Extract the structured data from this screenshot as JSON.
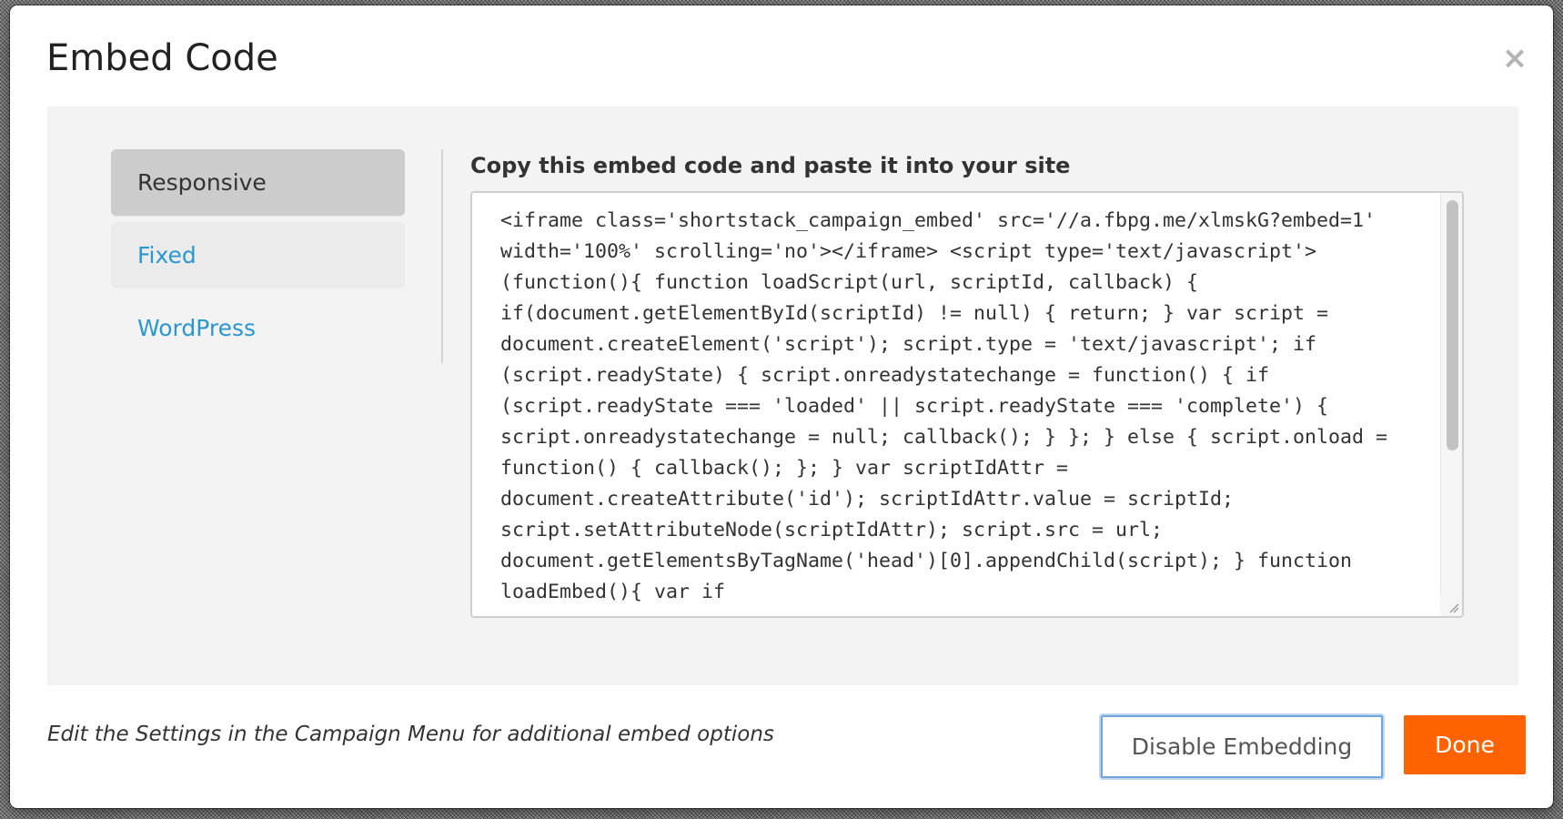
{
  "modal": {
    "title": "Embed Code",
    "close_glyph": "×",
    "close_icon": "close-icon"
  },
  "nav": {
    "items": [
      {
        "label": "Responsive",
        "state": "active"
      },
      {
        "label": "Fixed",
        "state": "hover"
      },
      {
        "label": "WordPress",
        "state": "default"
      }
    ]
  },
  "embed": {
    "label": "Copy this embed code and paste it into your site",
    "code": "<iframe class='shortstack_campaign_embed' src='//a.fbpg.me/xlmskG?embed=1' width='100%' scrolling='no'></iframe> <script type='text/javascript'> (function(){ function loadScript(url, scriptId, callback) { if(document.getElementById(scriptId) != null) { return; } var script = document.createElement('script'); script.type = 'text/javascript'; if (script.readyState) { script.onreadystatechange = function() { if (script.readyState === 'loaded' || script.readyState === 'complete') { script.onreadystatechange = null; callback(); } }; } else { script.onload = function() { callback(); }; } var scriptIdAttr = document.createAttribute('id'); scriptIdAttr.value = scriptId; script.setAttributeNode(scriptIdAttr); script.src = url; document.getElementsByTagName('head')[0].appendChild(script); } function loadEmbed(){ var if"
  },
  "footer": {
    "note": "Edit the Settings in the Campaign Menu for additional embed options",
    "disable_label": "Disable Embedding",
    "done_label": "Done"
  },
  "colors": {
    "accent_link": "#2a97d2",
    "done_button": "#ff6200",
    "focus_ring": "#6fa4dc"
  }
}
